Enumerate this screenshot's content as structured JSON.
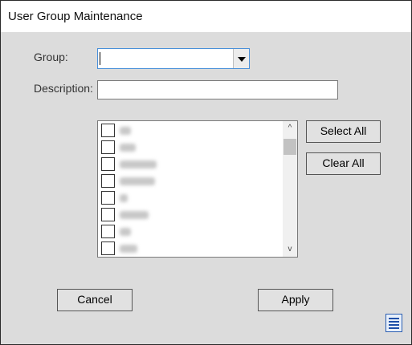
{
  "window": {
    "title": "User Group Maintenance"
  },
  "form": {
    "group_label": "Group:",
    "group_value": "",
    "description_label": "Description:",
    "description_value": ""
  },
  "list": {
    "items": [
      {
        "checked": false,
        "label_redacted": true
      },
      {
        "checked": false,
        "label_redacted": true
      },
      {
        "checked": false,
        "label_redacted": true
      },
      {
        "checked": false,
        "label_redacted": true
      },
      {
        "checked": false,
        "label_redacted": true
      },
      {
        "checked": false,
        "label_redacted": true
      },
      {
        "checked": false,
        "label_redacted": true
      },
      {
        "checked": false,
        "label_redacted": true
      }
    ],
    "scroll_up_glyph": "^",
    "scroll_down_glyph": "v"
  },
  "buttons": {
    "select_all": "Select All",
    "clear_all": "Clear All",
    "cancel": "Cancel",
    "apply": "Apply"
  },
  "icons": {
    "dropdown": "chevron-down-icon",
    "menu": "hamburger-menu-icon"
  },
  "colors": {
    "dialog_bg": "#dcdcdc",
    "focus_border": "#4a90d9",
    "menu_icon": "#1e4fa8"
  }
}
